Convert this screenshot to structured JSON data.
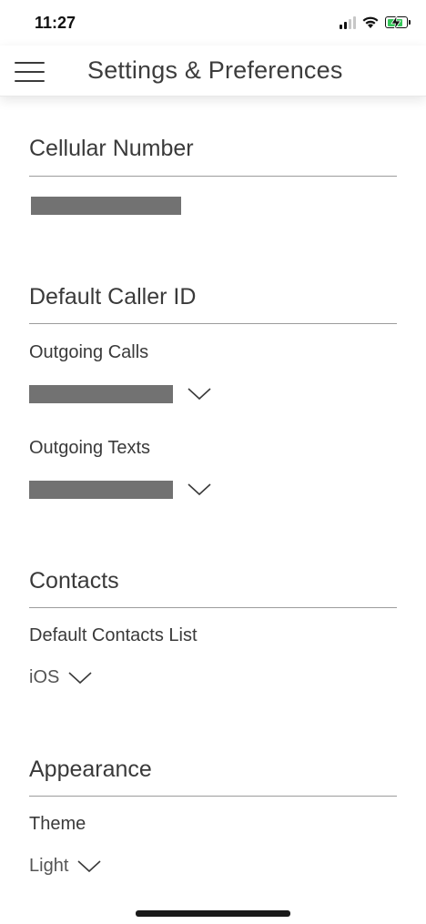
{
  "status_bar": {
    "time": "11:27",
    "icons": [
      "cellular-signal-icon",
      "wifi-icon",
      "battery-charging-icon"
    ],
    "battery_color": "#34c759"
  },
  "header": {
    "title": "Settings & Preferences",
    "menu_icon": "hamburger-menu-icon"
  },
  "sections": {
    "cellular": {
      "title": "Cellular Number",
      "value_redacted": true
    },
    "caller_id": {
      "title": "Default Caller ID",
      "outgoing_calls_label": "Outgoing Calls",
      "outgoing_texts_label": "Outgoing Texts"
    },
    "contacts": {
      "title": "Contacts",
      "default_list_label": "Default Contacts List",
      "default_list_value": "iOS"
    },
    "appearance": {
      "title": "Appearance",
      "theme_label": "Theme",
      "theme_value": "Light"
    }
  },
  "colors": {
    "text": "#3a3a3a",
    "divider": "#9c9c9c",
    "redaction": "#727272"
  }
}
